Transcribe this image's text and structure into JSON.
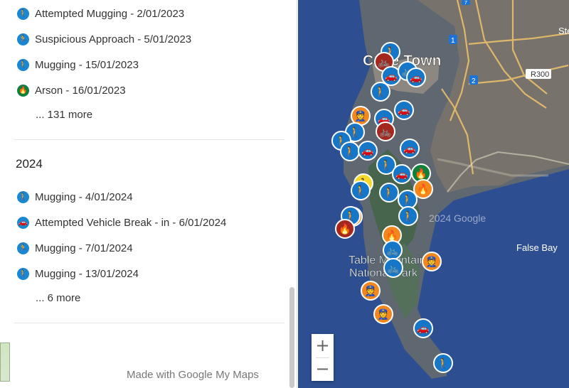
{
  "sidebar": {
    "group2023_items": [
      {
        "label": "Attempted Mugging - 2/01/2023",
        "icon": "walker-icon",
        "color": "#1987d2"
      },
      {
        "label": "Suspicious Approach - 5/01/2023",
        "icon": "runner-icon",
        "color": "#1987d2"
      },
      {
        "label": "Mugging - 15/01/2023",
        "icon": "walker-icon",
        "color": "#1987d2"
      },
      {
        "label": "Arson - 16/01/2023",
        "icon": "fire-icon",
        "color": "#0f7f3d"
      }
    ],
    "group2023_more": "... 131 more",
    "year_2024": "2024",
    "group2024_items": [
      {
        "label": "Mugging - 4/01/2024",
        "icon": "walker-icon",
        "color": "#1987d2"
      },
      {
        "label": "Attempted Vehicle Break - in - 6/01/2024",
        "icon": "car-icon",
        "color": "#1987d2"
      },
      {
        "label": "Mugging - 7/01/2024",
        "icon": "runner-icon",
        "color": "#1987d2"
      },
      {
        "label": "Mugging - 13/01/2024",
        "icon": "walker-icon",
        "color": "#1987d2"
      }
    ],
    "group2024_more": "... 6 more",
    "footer": "Made with Google My Maps"
  },
  "map": {
    "labels": {
      "city": "Cape Town",
      "park_line1": "Table Mountain",
      "park_line2": "National Park",
      "bay": "False Bay",
      "watermark": "2024 Google",
      "road": "R300",
      "route_1": "1",
      "route_2": "2",
      "route_7": "7",
      "side_label": "Ste"
    },
    "colors": {
      "water": "#2d4f91",
      "land": "#5f6770",
      "blue_marker": "#1677c8",
      "orange_marker": "#f2881d",
      "red_marker": "#a4281d",
      "green_marker": "#12803b",
      "yellow_marker": "#f7d82a"
    },
    "markers": [
      {
        "icon": "walker",
        "color": "blue"
      },
      {
        "icon": "bike",
        "color": "red"
      },
      {
        "icon": "car",
        "color": "blue"
      },
      {
        "icon": "bike",
        "color": "blue"
      },
      {
        "icon": "car",
        "color": "blue"
      },
      {
        "icon": "walker",
        "color": "blue"
      },
      {
        "icon": "guard",
        "color": "orange"
      },
      {
        "icon": "car",
        "color": "blue"
      },
      {
        "icon": "car",
        "color": "blue"
      },
      {
        "icon": "walker",
        "color": "blue"
      },
      {
        "icon": "bike",
        "color": "red"
      },
      {
        "icon": "walker",
        "color": "blue"
      },
      {
        "icon": "walker",
        "color": "blue"
      },
      {
        "icon": "car",
        "color": "blue"
      },
      {
        "icon": "car",
        "color": "blue"
      },
      {
        "icon": "walker",
        "color": "blue"
      },
      {
        "icon": "car",
        "color": "blue"
      },
      {
        "icon": "fire",
        "color": "green"
      },
      {
        "icon": "walker",
        "color": "yellow"
      },
      {
        "icon": "walker",
        "color": "blue"
      },
      {
        "icon": "fire",
        "color": "orange"
      },
      {
        "icon": "walker",
        "color": "blue"
      },
      {
        "icon": "walker",
        "color": "blue"
      },
      {
        "icon": "fire",
        "color": "orange"
      },
      {
        "icon": "walker",
        "color": "blue"
      },
      {
        "icon": "fire",
        "color": "red"
      },
      {
        "icon": "fire",
        "color": "orange"
      },
      {
        "icon": "walker",
        "color": "blue"
      },
      {
        "icon": "bike",
        "color": "blue"
      },
      {
        "icon": "guard",
        "color": "orange"
      },
      {
        "icon": "bike",
        "color": "blue"
      },
      {
        "icon": "guard",
        "color": "orange"
      },
      {
        "icon": "guard",
        "color": "orange"
      },
      {
        "icon": "car",
        "color": "blue"
      },
      {
        "icon": "walker",
        "color": "blue"
      }
    ]
  },
  "controls": {
    "zoom_in": "+",
    "zoom_out": "−"
  }
}
